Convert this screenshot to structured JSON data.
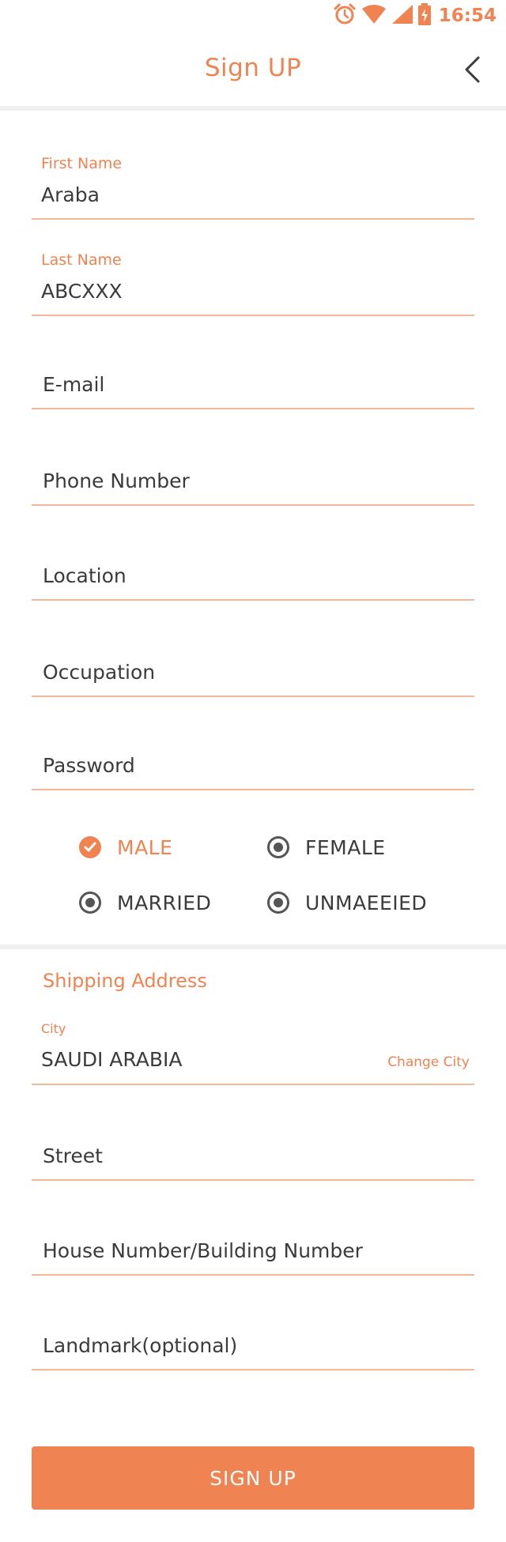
{
  "status_bar": {
    "time": "16:54",
    "icons": [
      "alarm-icon",
      "wifi-icon",
      "signal-icon",
      "battery-charging-icon"
    ],
    "accent": "#ef8351"
  },
  "header": {
    "title": "Sign UP",
    "back_icon": "chevron-left-icon"
  },
  "form": {
    "first_name": {
      "label": "First Name",
      "value": "Araba"
    },
    "last_name": {
      "label": "Last Name",
      "value": "ABCXXX"
    },
    "email": {
      "placeholder": "E-mail"
    },
    "phone": {
      "placeholder": "Phone Number"
    },
    "location": {
      "placeholder": "Location"
    },
    "occupation": {
      "placeholder": "Occupation"
    },
    "password": {
      "placeholder": "Password"
    },
    "gender": {
      "male": {
        "label": "MALE",
        "selected": true
      },
      "female": {
        "label": "FEMALE",
        "selected": false
      }
    },
    "marital": {
      "married": {
        "label": "MARRIED",
        "selected": false
      },
      "unmarried": {
        "label": "UNMAEEIED",
        "selected": false
      }
    }
  },
  "shipping": {
    "section_title": "Shipping Address",
    "city": {
      "label": "City",
      "value": "SAUDI ARABIA",
      "action": "Change City"
    },
    "street": {
      "placeholder": "Street"
    },
    "house": {
      "placeholder": "House Number/Building Number"
    },
    "landmark": {
      "placeholder": "Landmark(optional)"
    }
  },
  "actions": {
    "signup_label": "SIGN UP"
  },
  "colors": {
    "accent": "#ef8351",
    "underline": "#f3b79a",
    "divider": "#efefef"
  }
}
